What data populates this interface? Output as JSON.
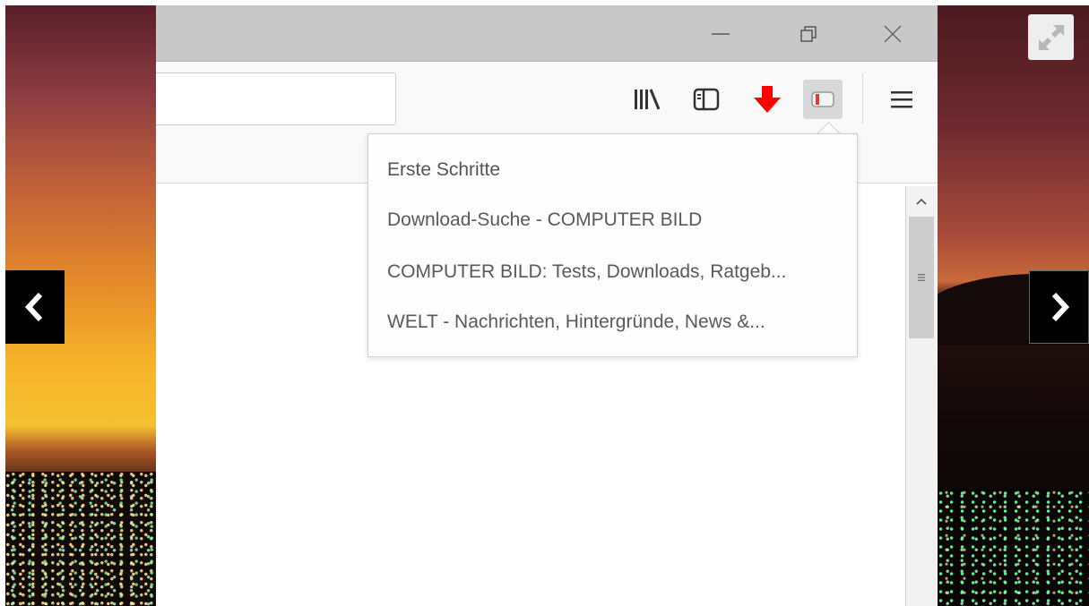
{
  "browser": {
    "window_controls": {
      "minimize_icon": "minimize-icon",
      "restore_icon": "restore-icon",
      "close_icon": "close-icon"
    },
    "toolbar": {
      "url_value": "",
      "buttons": [
        "library-icon",
        "sidebar-icon",
        "download-arrow-icon",
        "addon-icon",
        "hamburger-menu-icon"
      ],
      "download_color": "#ff0000",
      "addon_accent": "#e03c3c"
    },
    "panel": {
      "heading": "Erste Schritte",
      "items": [
        {
          "label": "Download-Suche - COMPUTER BILD"
        },
        {
          "label": "COMPUTER BILD: Tests, Downloads, Ratgeb..."
        },
        {
          "label": "WELT - Nachrichten, Hintergründe, News &..."
        }
      ]
    }
  },
  "slideshow": {
    "prev_icon": "chevron-left-icon",
    "next_icon": "chevron-right-icon",
    "fullscreen_icon": "expand-arrows-icon"
  }
}
